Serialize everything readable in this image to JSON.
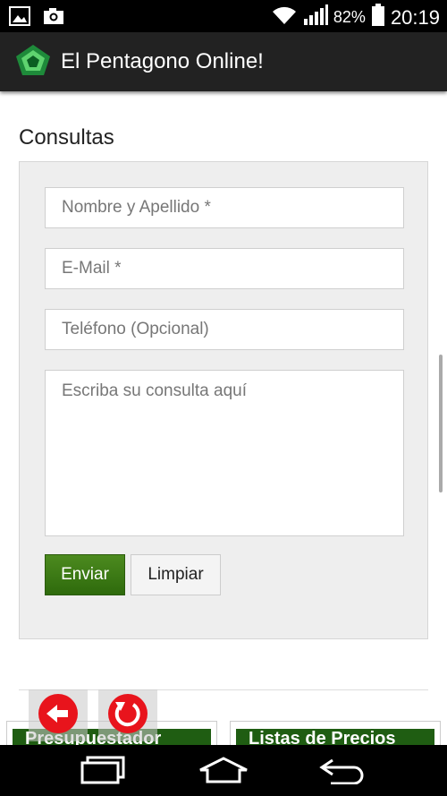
{
  "status_bar": {
    "battery_percent": "82%",
    "time": "20:19",
    "icons": [
      "image-icon",
      "camera-icon",
      "wifi-icon",
      "signal-icon",
      "battery-icon"
    ]
  },
  "app_bar": {
    "title": "El Pentagono Online!",
    "logo": "pentagon-logo"
  },
  "page": {
    "section_title": "Consultas",
    "form": {
      "name_placeholder": "Nombre y Apellido *",
      "email_placeholder": "E-Mail *",
      "phone_placeholder": "Teléfono (Opcional)",
      "message_placeholder": "Escriba su consulta aquí",
      "send_label": "Enviar",
      "clear_label": "Limpiar"
    },
    "cards": [
      {
        "label": "Presupuestador"
      },
      {
        "label": "Listas de Precios"
      }
    ],
    "floating_buttons": [
      "back-arrow-icon",
      "refresh-icon"
    ]
  },
  "colors": {
    "accent_green": "#2e6a0c",
    "app_bar": "#222222",
    "floating_red": "#e8141c"
  },
  "nav_bar": {
    "icons": [
      "recent-apps-icon",
      "home-icon",
      "back-icon"
    ]
  }
}
